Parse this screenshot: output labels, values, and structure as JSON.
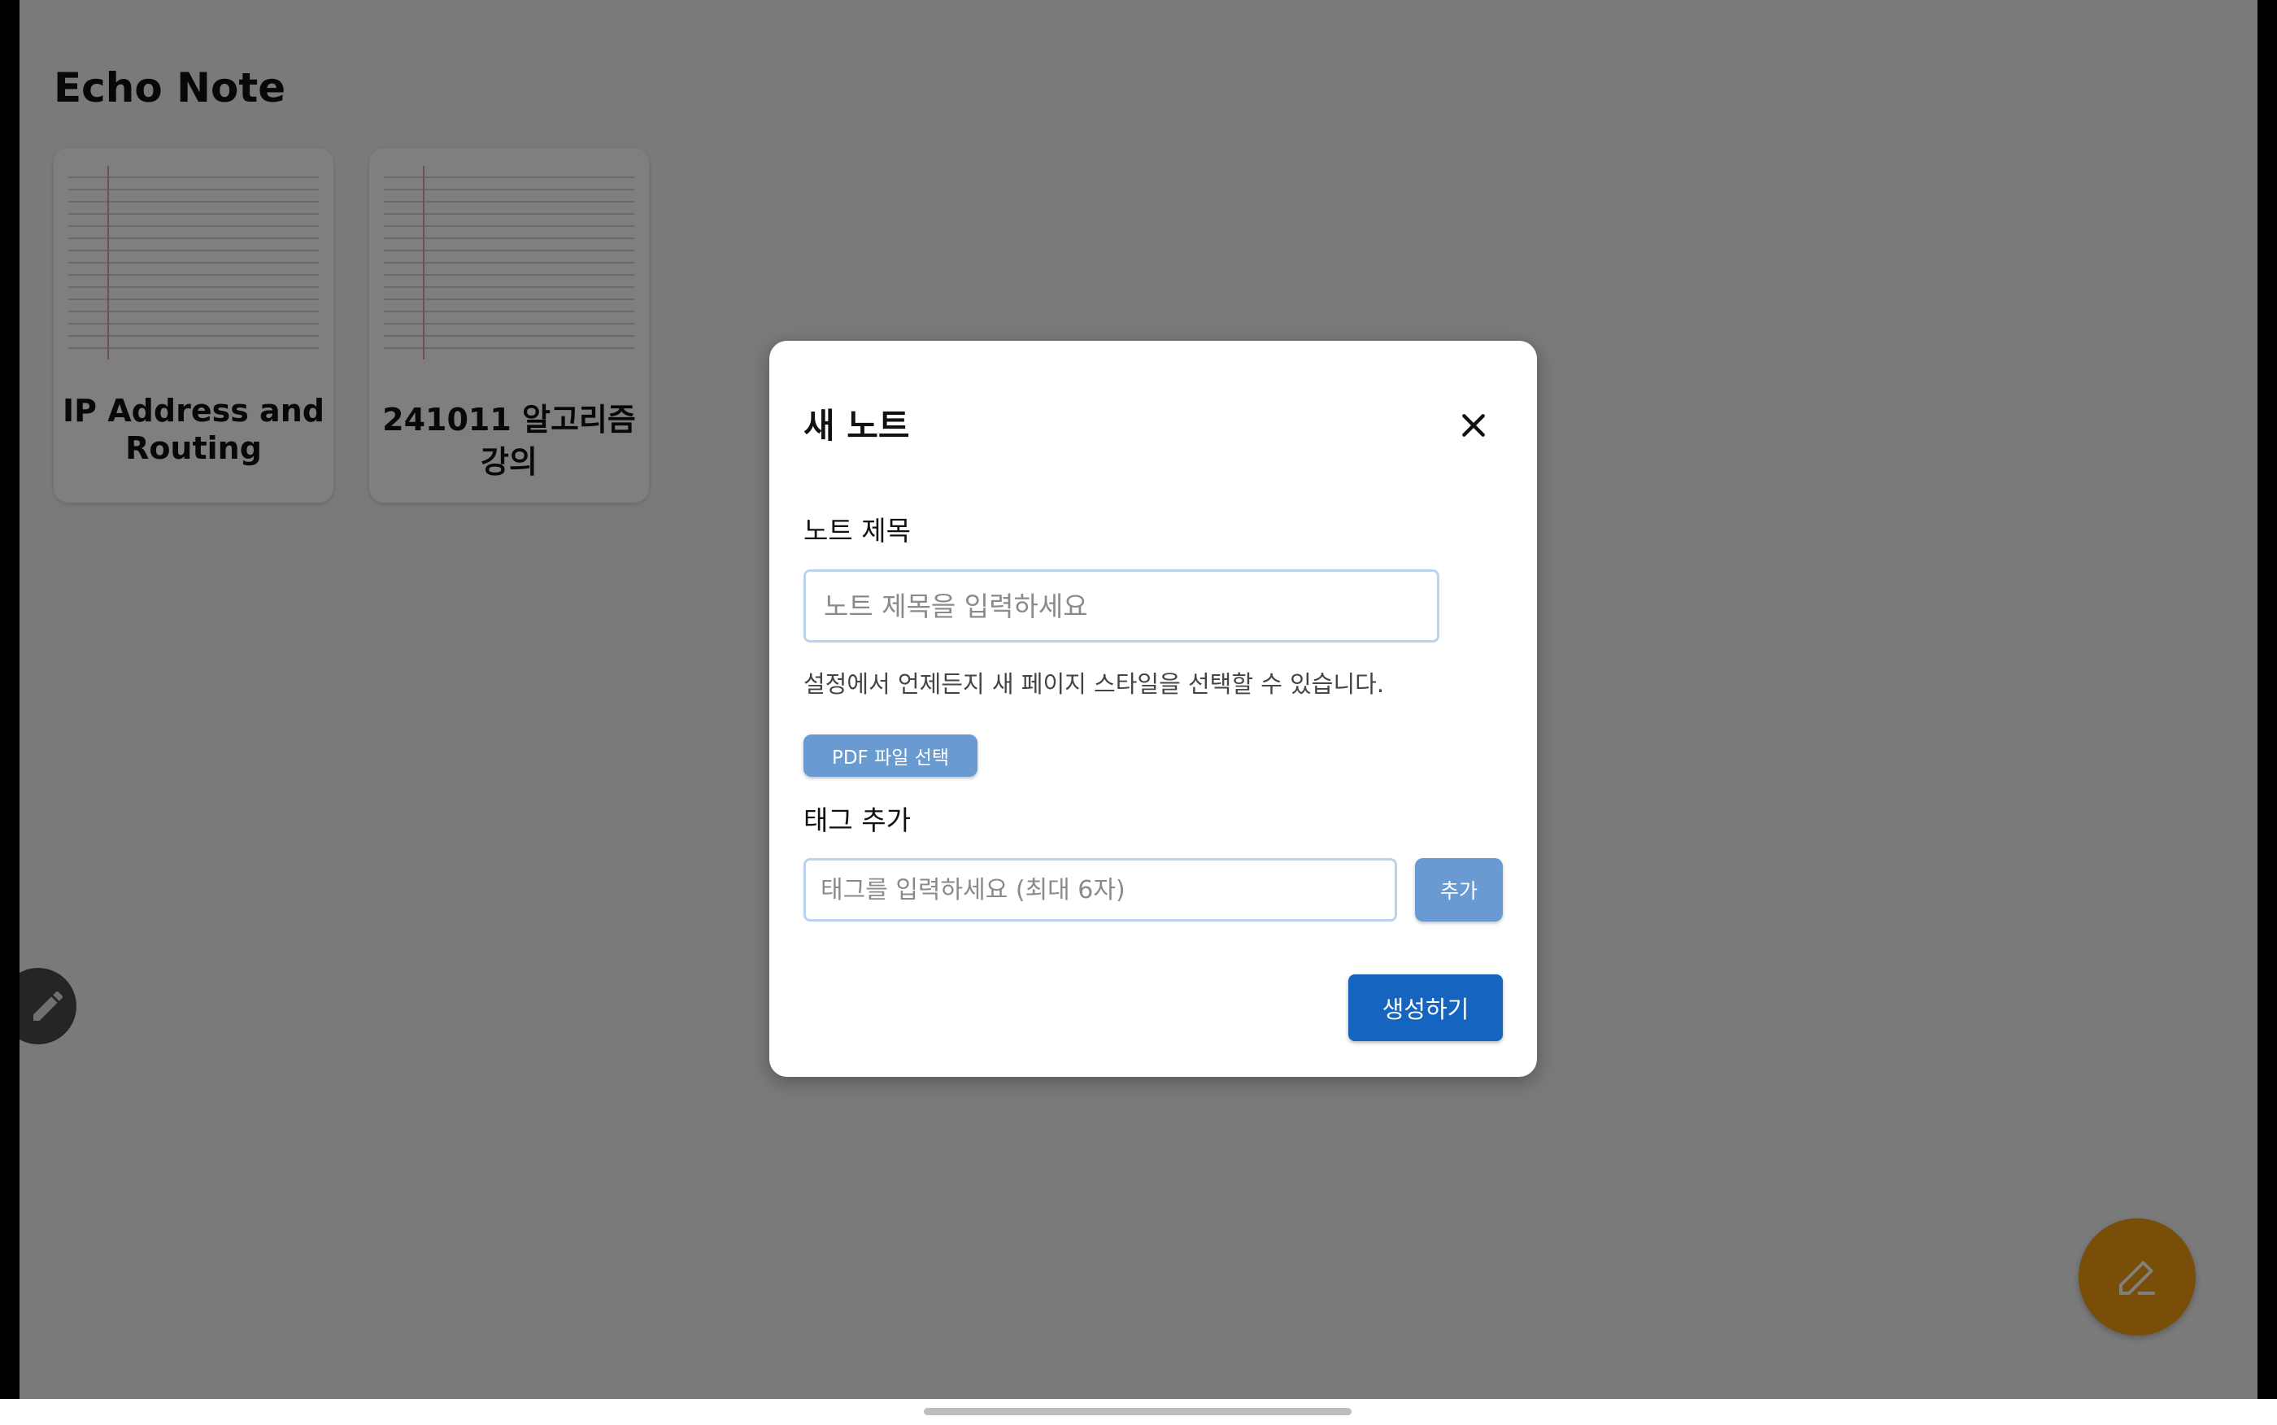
{
  "app": {
    "title": "Echo Note"
  },
  "notes": [
    {
      "title": "IP Address and Routing"
    },
    {
      "title": "241011 알고리즘 강의"
    }
  ],
  "icons": {
    "side_fab": "pencil-icon",
    "main_fab": "pen-icon",
    "close": "close-icon"
  },
  "dialog": {
    "title": "새 노트",
    "note_title_label": "노트 제목",
    "note_title_placeholder": "노트 제목을 입력하세요",
    "note_title_value": "",
    "hint": "설정에서 언제든지 새 페이지 스타일을 선택할 수 있습니다.",
    "pdf_button": "PDF 파일 선택",
    "tag_label": "태그 추가",
    "tag_placeholder": "태그를 입력하세요 (최대 6자)",
    "tag_value": "",
    "add_button": "추가",
    "create_button": "생성하기"
  },
  "colors": {
    "fab": "#f39c12",
    "primary": "#1565c0",
    "secondary_button": "#6a9ad2",
    "overlay": "rgba(0,0,0,0.5)"
  }
}
